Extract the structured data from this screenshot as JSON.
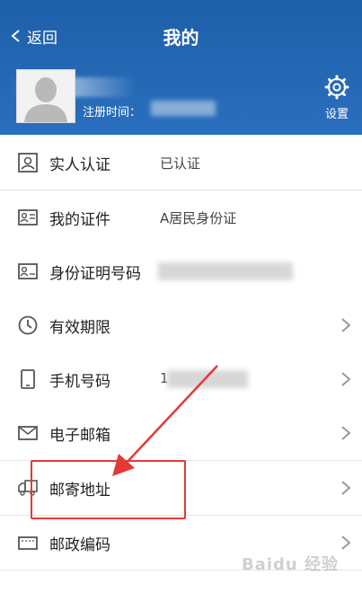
{
  "header": {
    "back_label": "返回",
    "title": "我的",
    "registration_label": "注册时间：",
    "settings_label": "设置"
  },
  "menu": {
    "items": [
      {
        "label": "实人认证",
        "value": "已认证",
        "icon": "person-verify-icon",
        "has_chevron": false
      },
      {
        "label": "我的证件",
        "value": "A居民身份证",
        "icon": "id-card-icon",
        "has_chevron": false
      },
      {
        "label": "身份证明号码",
        "value": "",
        "icon": "id-number-icon",
        "has_chevron": false
      },
      {
        "label": "有效期限",
        "value": "",
        "icon": "clock-icon",
        "has_chevron": true
      },
      {
        "label": "手机号码",
        "value": "1",
        "icon": "phone-icon",
        "has_chevron": true
      },
      {
        "label": "电子邮箱",
        "value": "",
        "icon": "mail-icon",
        "has_chevron": true
      },
      {
        "label": "邮寄地址",
        "value": "",
        "icon": "truck-icon",
        "has_chevron": true
      },
      {
        "label": "邮政编码",
        "value": "",
        "icon": "postal-icon",
        "has_chevron": true
      }
    ]
  },
  "watermark": "Baidu 经验",
  "colors": {
    "header_bg": "#2a6fbe",
    "highlight": "#e53935"
  }
}
